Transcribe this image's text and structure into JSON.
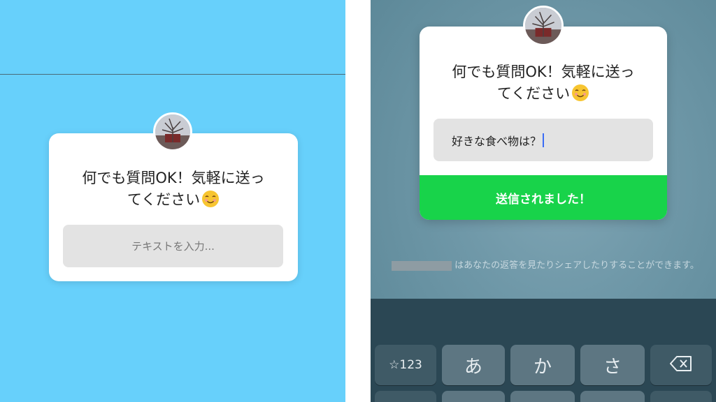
{
  "colors": {
    "left_background": "#67d0fb",
    "right_background": "#6f98a8",
    "sent_bar": "#18d34a",
    "keyboard": "#2b4754",
    "caret": "#3b6cf5"
  },
  "left_panel": {
    "question_line1": "何でも質問OK！気軽に送っ",
    "question_line2": "てください",
    "emoji": "☺",
    "input_placeholder": "テキストを入力..."
  },
  "right_panel": {
    "question_line1": "何でも質問OK！気軽に送っ",
    "question_line2": "てください",
    "emoji": "☺",
    "answer_text": "好きな食べ物は？",
    "sent_label": "送信されました！",
    "notice_text": "はあなたの返答を見たりシェアしたりすることができます。"
  },
  "keyboard": {
    "keys": [
      "☆123",
      "あ",
      "か",
      "さ"
    ],
    "delete_icon": "backspace-icon"
  }
}
